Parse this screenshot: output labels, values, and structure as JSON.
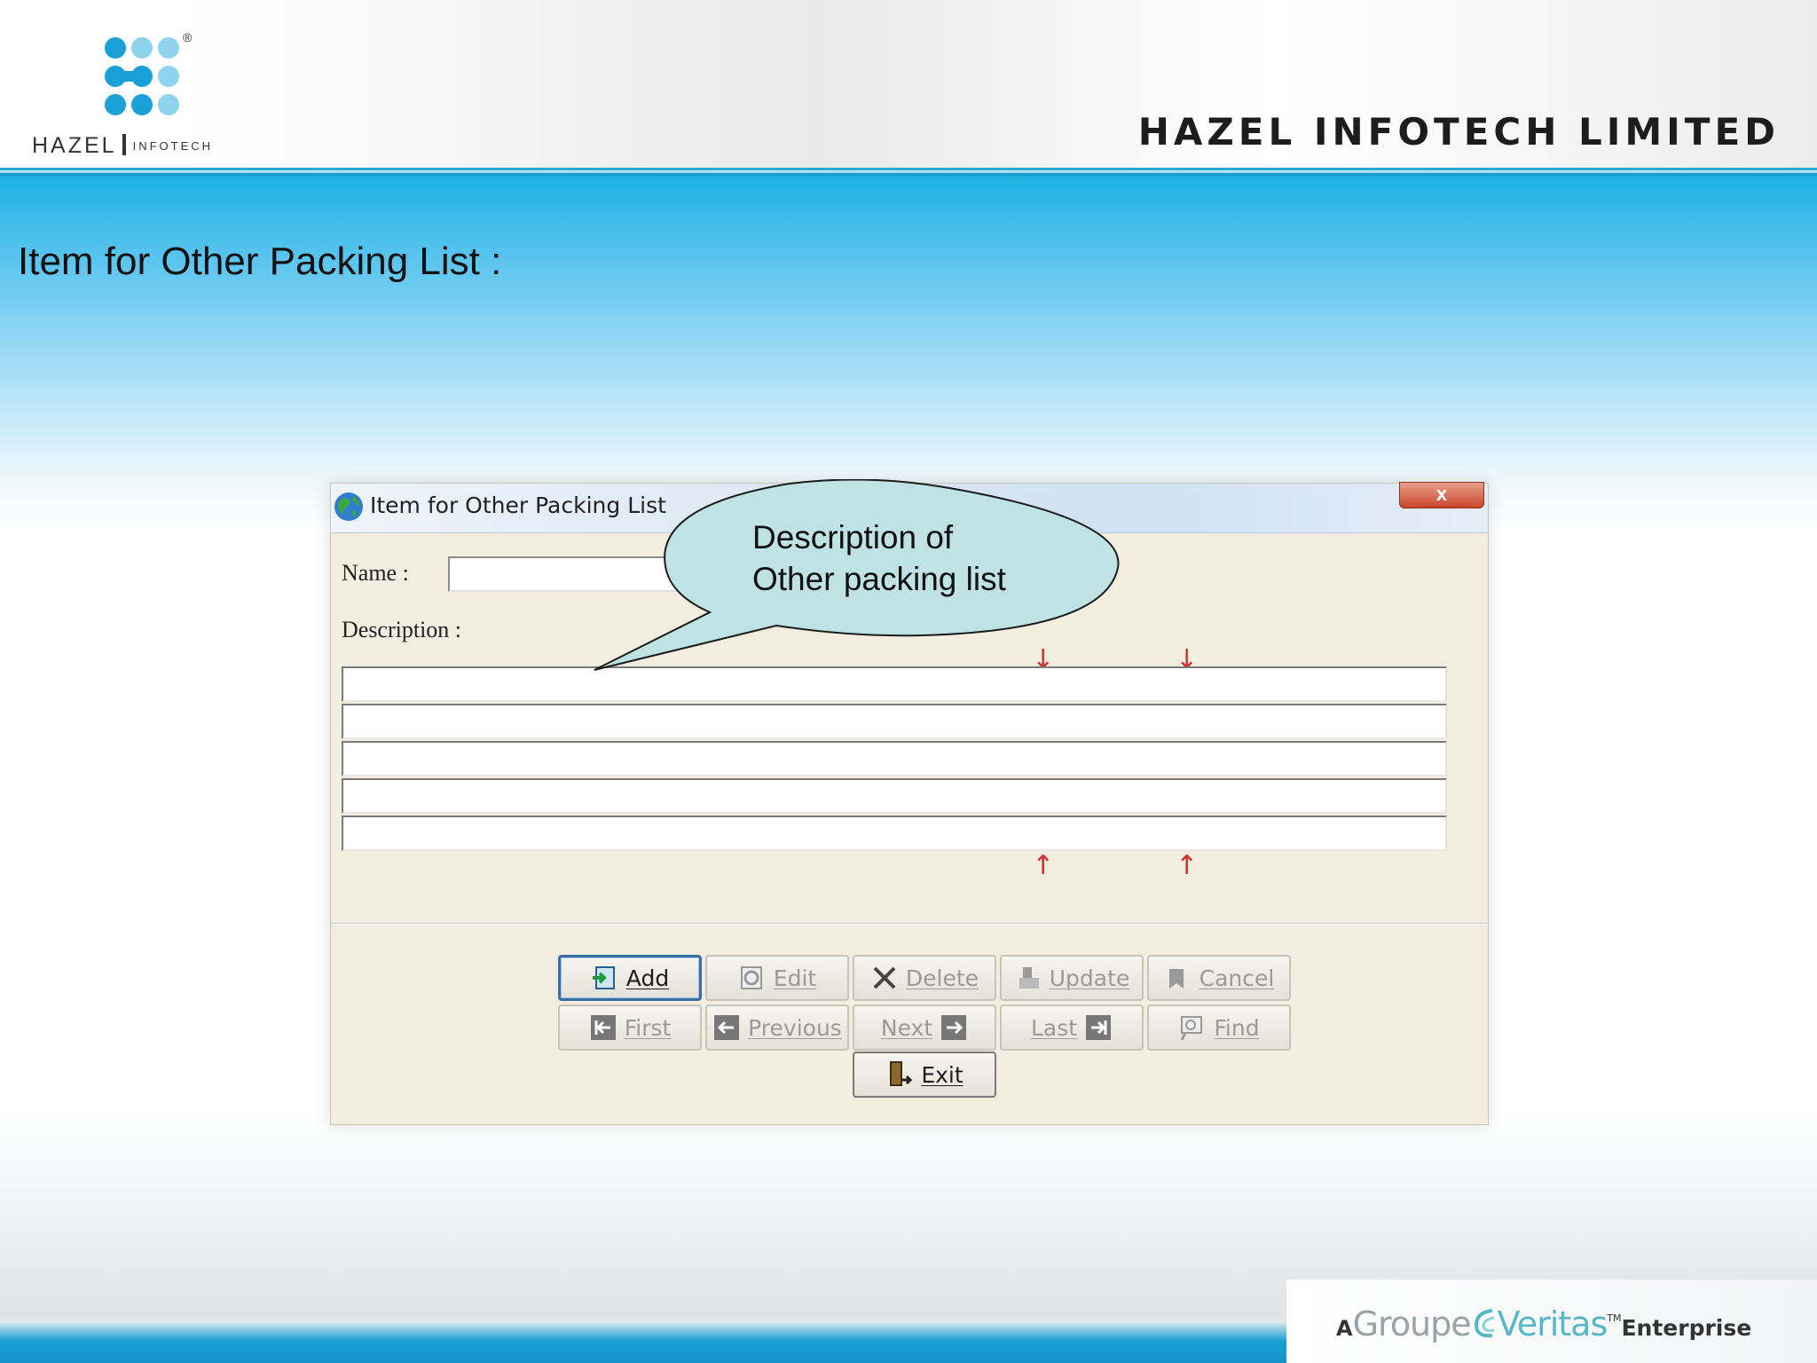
{
  "header": {
    "logo_text": "HAZEL",
    "logo_subtext": "INFOTECH",
    "registered_mark": "®",
    "company_name": "HAZEL INFOTECH LIMITED",
    "colors": {
      "logo_dark": "#1a9fd7",
      "logo_light": "#8fd3ee",
      "accent": "#1fb1e4"
    }
  },
  "slide": {
    "title": "Item for Other Packing List :"
  },
  "dialog": {
    "title": "Item for Other Packing List",
    "close_label": "x",
    "name_label": "Name :",
    "name_value": "",
    "description_label": "Description :",
    "description_lines": [
      "",
      "",
      "",
      "",
      ""
    ],
    "marker_down": "↓",
    "marker_up": "↑",
    "buttons": {
      "add": "Add",
      "edit": "Edit",
      "delete": "Delete",
      "update": "Update",
      "cancel": "Cancel",
      "first": "First",
      "previous": "Previous",
      "next": "Next",
      "last": "Last",
      "find": "Find",
      "exit": "Exit"
    }
  },
  "callout": {
    "line1": "Description of",
    "line2": "Other packing list",
    "fill": "#bfe2e4"
  },
  "footer": {
    "brand_prefix": "A",
    "brand_groupe": "Groupe",
    "brand_veritas": "Veritas",
    "brand_tm": "TM",
    "brand_suffix": "Enterprise"
  }
}
